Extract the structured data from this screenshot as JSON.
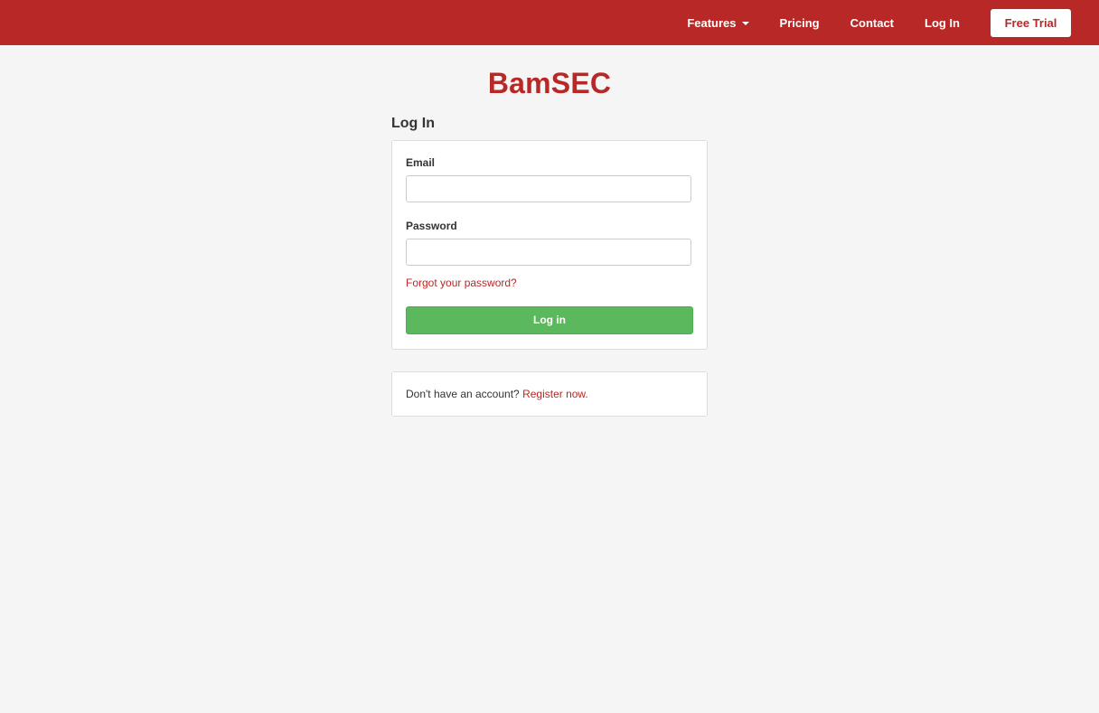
{
  "nav": {
    "features_label": "Features",
    "pricing_label": "Pricing",
    "contact_label": "Contact",
    "login_label": "Log In",
    "free_trial_label": "Free Trial"
  },
  "logo_text": "BamSEC",
  "login": {
    "heading": "Log In",
    "email_label": "Email",
    "email_value": "",
    "password_label": "Password",
    "password_value": "",
    "forgot_label": "Forgot your password?",
    "submit_label": "Log in"
  },
  "register": {
    "prompt": "Don't have an account?",
    "link_label": "Register now."
  },
  "colors": {
    "brand_red": "#b82826",
    "login_button_green": "#5cb85c",
    "page_background": "#f5f5f5"
  },
  "icons": {
    "features_dropdown": "caret-down-icon"
  }
}
